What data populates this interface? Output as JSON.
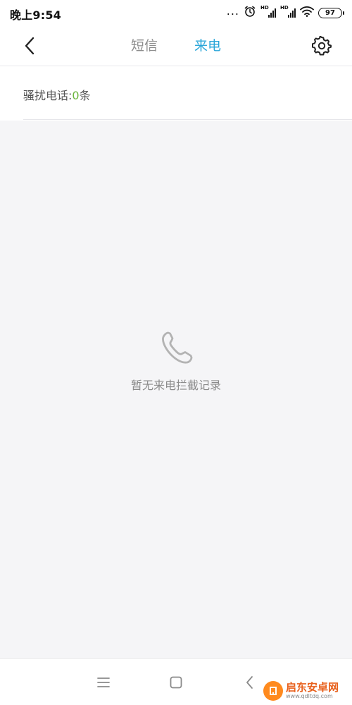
{
  "status_bar": {
    "time": "晚上9:54",
    "dots": "...",
    "signal_1_label": "HD",
    "signal_2_label": "HD",
    "battery": "97",
    "icons": [
      "alarm-icon",
      "signal-icon",
      "signal-icon",
      "wifi-icon",
      "battery-icon"
    ]
  },
  "header": {
    "back_icon": "back-arrow-icon",
    "tabs": [
      {
        "label": "短信",
        "active": false
      },
      {
        "label": "来电",
        "active": true
      }
    ],
    "settings_icon": "gear-icon",
    "active_color": "#2aa6d9"
  },
  "summary": {
    "label": "骚扰电话:",
    "count": "0",
    "unit": "条",
    "count_color": "#6ab53c"
  },
  "empty_state": {
    "icon": "phone-icon",
    "text": "暂无来电拦截记录"
  },
  "system_nav": {
    "menu_icon": "menu-icon",
    "home_icon": "home-icon",
    "back_icon": "back-icon"
  },
  "watermark": {
    "title": "启东安卓网",
    "url": "www.qdltdq.com"
  }
}
